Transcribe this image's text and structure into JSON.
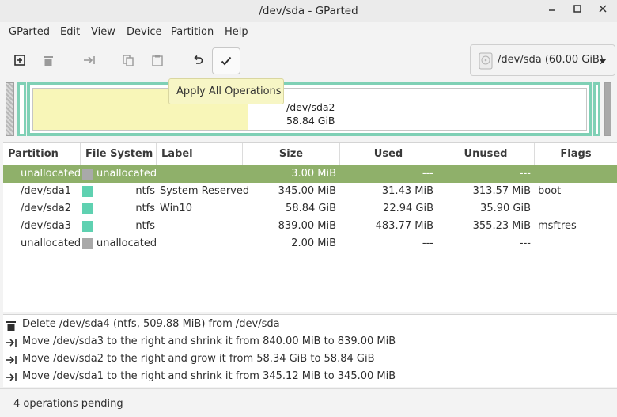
{
  "window": {
    "title": "/dev/sda - GParted"
  },
  "menu": [
    "GParted",
    "Edit",
    "View",
    "Device",
    "Partition",
    "Help"
  ],
  "toolbar": {
    "buttons": [
      {
        "name": "new-partition",
        "icon": "new-icon"
      },
      {
        "name": "delete-partition",
        "icon": "trash-icon"
      },
      {
        "name": "resize-move",
        "icon": "arrow-right-bar-icon"
      },
      {
        "name": "copy",
        "icon": "copy-icon"
      },
      {
        "name": "paste",
        "icon": "paste-icon"
      },
      {
        "name": "undo",
        "icon": "undo-icon"
      },
      {
        "name": "apply",
        "icon": "checkmark-icon"
      }
    ],
    "tooltip": "Apply All Operations",
    "device": "/dev/sda (60.00 GiB)"
  },
  "diskmap": {
    "sda2_name": "/dev/sda2",
    "sda2_size": "58.84 GiB"
  },
  "table": {
    "headers": [
      "Partition",
      "File System",
      "Label",
      "Size",
      "Used",
      "Unused",
      "Flags"
    ],
    "rows": [
      {
        "partition": "unallocated",
        "fs": "unallocated",
        "fs_color": "#a9a9a9",
        "label": "",
        "size": "3.00 MiB",
        "used": "---",
        "unused": "---",
        "flags": "",
        "selected": true
      },
      {
        "partition": "/dev/sda1",
        "fs": "ntfs",
        "fs_color": "#5fd1b1",
        "label": "System Reserved",
        "size": "345.00 MiB",
        "used": "31.43 MiB",
        "unused": "313.57 MiB",
        "flags": "boot"
      },
      {
        "partition": "/dev/sda2",
        "fs": "ntfs",
        "fs_color": "#5fd1b1",
        "label": "Win10",
        "size": "58.84 GiB",
        "used": "22.94 GiB",
        "unused": "35.90 GiB",
        "flags": ""
      },
      {
        "partition": "/dev/sda3",
        "fs": "ntfs",
        "fs_color": "#5fd1b1",
        "label": "",
        "size": "839.00 MiB",
        "used": "483.77 MiB",
        "unused": "355.23 MiB",
        "flags": "msftres"
      },
      {
        "partition": "unallocated",
        "fs": "unallocated",
        "fs_color": "#a9a9a9",
        "label": "",
        "size": "2.00 MiB",
        "used": "---",
        "unused": "---",
        "flags": ""
      }
    ]
  },
  "operations": [
    {
      "icon": "trash-icon",
      "text": "Delete /dev/sda4 (ntfs, 509.88 MiB) from /dev/sda"
    },
    {
      "icon": "arrow-right-bar-icon",
      "text": "Move /dev/sda3 to the right and shrink it from 840.00 MiB to 839.00 MiB"
    },
    {
      "icon": "arrow-right-bar-icon",
      "text": "Move /dev/sda2 to the right and grow it from 58.34 GiB to 58.84 GiB"
    },
    {
      "icon": "arrow-right-bar-icon",
      "text": "Move /dev/sda1 to the right and shrink it from 345.12 MiB to 345.00 MiB"
    }
  ],
  "status": "4 operations pending"
}
